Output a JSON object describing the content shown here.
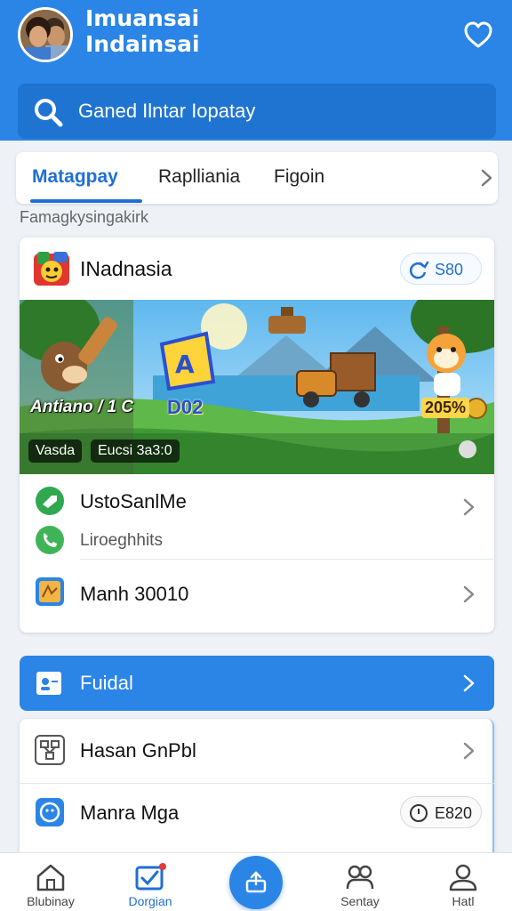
{
  "header": {
    "title_line1": "Imuansai",
    "title_line2": "Indainsai"
  },
  "search": {
    "placeholder": "Ganed Ilntar Iopatay"
  },
  "tabs": [
    {
      "label": "Matagpay",
      "active": true
    },
    {
      "label": "Raplliania",
      "active": false
    },
    {
      "label": "Figoin",
      "active": false
    }
  ],
  "section_label": "Famagkysingakirk",
  "card": {
    "title": "INadnasia",
    "badge": "S80",
    "banner": {
      "text_left": "Antiano / 1 C",
      "text_center": "D02",
      "text_right": "205%",
      "pill_1": "Vasda",
      "pill_2": "Eucsi 3a3:0"
    },
    "rows": [
      {
        "label": "UstoSanlMe",
        "sub": "Liroeghhits"
      },
      {
        "label": "Manh 30010"
      }
    ]
  },
  "fuidal": {
    "label": "Fuidal"
  },
  "card2": {
    "rows": [
      {
        "label": "Hasan GnPbl"
      },
      {
        "label": "Manra Mga",
        "badge": "E820"
      }
    ]
  },
  "nav": [
    {
      "label": "Blubinay"
    },
    {
      "label": "Dorgian"
    },
    {
      "label": "Sentay"
    },
    {
      "label": "Hatl"
    }
  ],
  "colors": {
    "primary": "#2a85e6",
    "primary_dark": "#1f74d2",
    "accent_text": "#1f6fd6",
    "background": "#eef2f7"
  }
}
